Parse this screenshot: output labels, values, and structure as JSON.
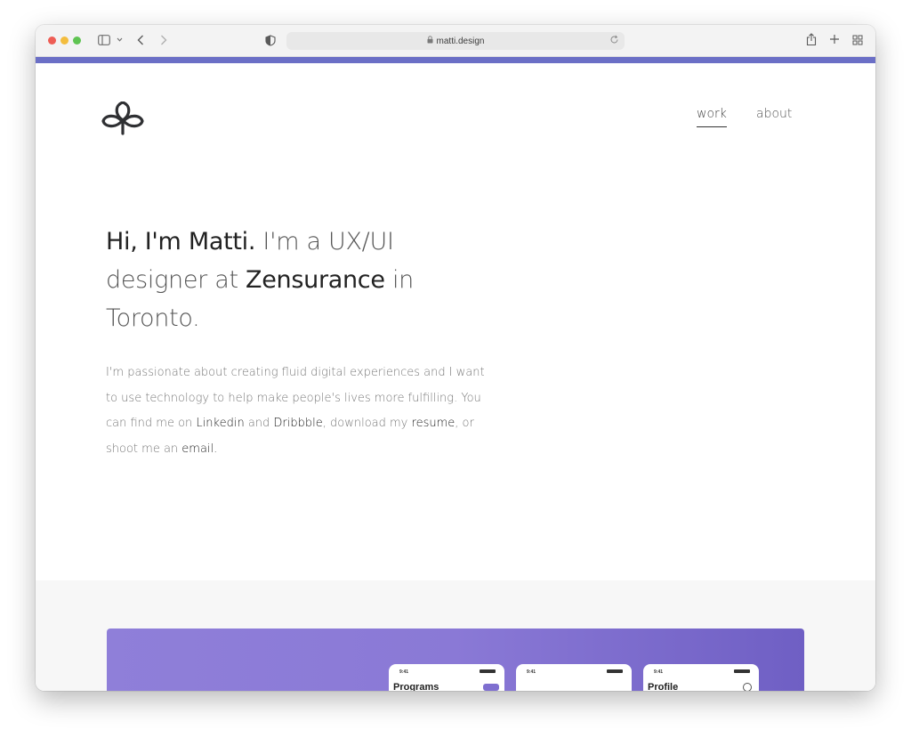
{
  "browser": {
    "url": "matti.design"
  },
  "colors": {
    "accent_bar": "#6b6fc6",
    "card_gradient_start": "#8f7fd9",
    "card_gradient_end": "#6f5fc4"
  },
  "nav": {
    "items": [
      {
        "label": "work",
        "active": true
      },
      {
        "label": "about",
        "active": false
      }
    ]
  },
  "hero": {
    "intro_strong": "Hi, I'm Matti.",
    "intro_rest": " I'm a UX/UI designer at ",
    "company": "Zensurance",
    "location": " in Toronto."
  },
  "bio": {
    "part1": "I'm passionate about creating fluid digital experiences and I want to use technology to help make people's lives more fulfilling. You can find me on ",
    "linkedin": "Linkedin",
    "and": " and ",
    "dribbble": "Dribbble",
    "part2": ", download my ",
    "resume": "resume",
    "part3": ", or shoot me an ",
    "email": "email",
    "end": "."
  },
  "showcase": {
    "phones": [
      {
        "time": "9:41",
        "title": "Programs"
      },
      {
        "time": "9:41",
        "title": ""
      },
      {
        "time": "9:41",
        "title": "Profile"
      }
    ]
  }
}
